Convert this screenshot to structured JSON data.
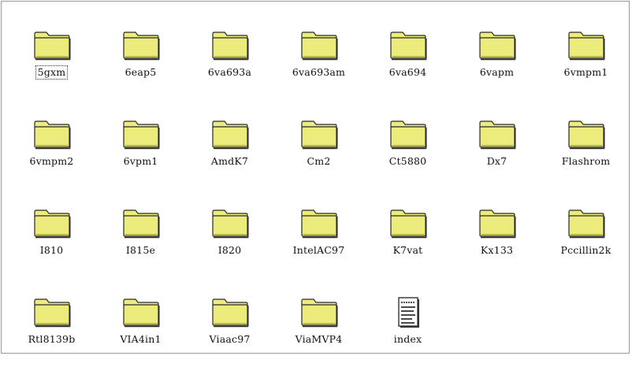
{
  "window": {
    "items": [
      {
        "label": "5gxm",
        "icon": "folder-icon"
      },
      {
        "label": "6eap5",
        "icon": "folder-icon"
      },
      {
        "label": "6va693a",
        "icon": "folder-icon"
      },
      {
        "label": "6va693am",
        "icon": "folder-icon"
      },
      {
        "label": "6va694",
        "icon": "folder-icon"
      },
      {
        "label": "6vapm",
        "icon": "folder-icon"
      },
      {
        "label": "6vmpm1",
        "icon": "folder-icon"
      },
      {
        "label": "6vmpm2",
        "icon": "folder-icon"
      },
      {
        "label": "6vpm1",
        "icon": "folder-icon"
      },
      {
        "label": "AmdK7",
        "icon": "folder-icon"
      },
      {
        "label": "Cm2",
        "icon": "folder-icon"
      },
      {
        "label": "Ct5880",
        "icon": "folder-icon"
      },
      {
        "label": "Dx7",
        "icon": "folder-icon"
      },
      {
        "label": "Flashrom",
        "icon": "folder-icon"
      },
      {
        "label": "I810",
        "icon": "folder-icon"
      },
      {
        "label": "I815e",
        "icon": "folder-icon"
      },
      {
        "label": "I820",
        "icon": "folder-icon"
      },
      {
        "label": "IntelAC97",
        "icon": "folder-icon"
      },
      {
        "label": "K7vat",
        "icon": "folder-icon"
      },
      {
        "label": "Kx133",
        "icon": "folder-icon"
      },
      {
        "label": "Pccillin2k",
        "icon": "folder-icon"
      },
      {
        "label": "Rtl8139b",
        "icon": "folder-icon"
      },
      {
        "label": "VIA4in1",
        "icon": "folder-icon"
      },
      {
        "label": "Viaac97",
        "icon": "folder-icon"
      },
      {
        "label": "ViaMVP4",
        "icon": "folder-icon"
      },
      {
        "label": "index",
        "icon": "document-icon"
      }
    ]
  },
  "colors": {
    "folder_fill": "#ecec7c",
    "folder_shadow": "#b9b94c",
    "folder_outline": "#2a2a2a",
    "document_lines": "#4a4a4a"
  }
}
